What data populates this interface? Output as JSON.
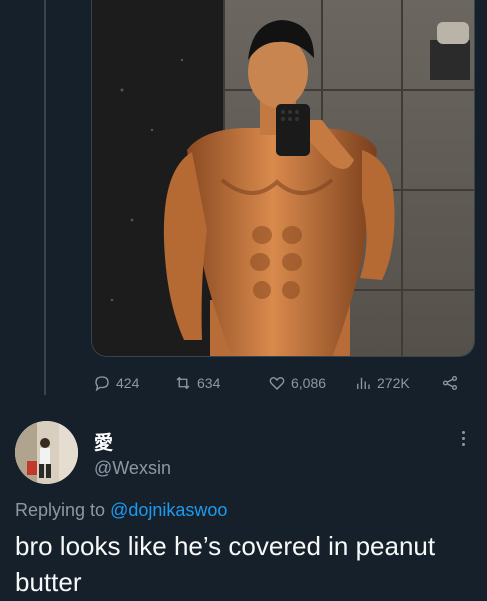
{
  "tweet": {
    "stats": {
      "replies": "424",
      "retweets": "634",
      "likes": "6,086",
      "views": "272K"
    }
  },
  "reply": {
    "display_name": "愛",
    "handle": "@Wexsin",
    "replying_prefix": "Replying to",
    "replying_to": "@dojnikaswoo",
    "text": "bro looks like he’s covered in peanut butter"
  },
  "colors": {
    "background": "#15202b",
    "secondary_text": "#8b98a5",
    "accent": "#1d9bf0",
    "border": "#38444d"
  },
  "icons": [
    "reply-icon",
    "retweet-icon",
    "like-icon",
    "views-icon",
    "share-icon",
    "more-icon"
  ]
}
